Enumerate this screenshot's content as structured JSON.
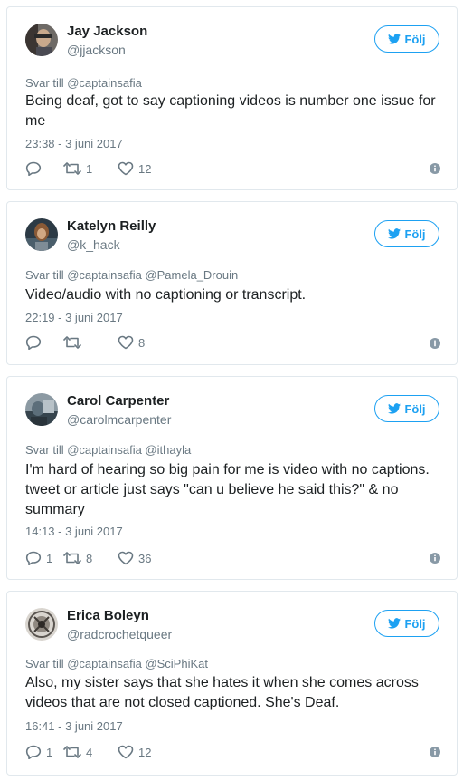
{
  "colors": {
    "accent": "#1da1f2",
    "secondary_text": "#697882",
    "primary_text": "#1c2022",
    "border": "#e1e8ed"
  },
  "tweets": [
    {
      "name": "Jay Jackson",
      "handle": "@jjackson",
      "follow_label": "Följ",
      "reply_to": "Svar till @captainsafia",
      "text_lines": [
        "Being deaf, got to say captioning videos is number one issue for",
        "me"
      ],
      "timestamp": "23:38 - 3 juni 2017",
      "replies": "",
      "retweets": "1",
      "likes": "12"
    },
    {
      "name": "Katelyn Reilly",
      "handle": "@k_hack",
      "follow_label": "Följ",
      "reply_to": "Svar till @captainsafia @Pamela_Drouin",
      "text_lines": [
        "Video/audio with no captioning or transcript."
      ],
      "timestamp": "22:19 - 3 juni 2017",
      "replies": "",
      "retweets": "",
      "likes": "8"
    },
    {
      "name": "Carol Carpenter",
      "handle": "@carolmcarpenter",
      "follow_label": "Följ",
      "reply_to": "Svar till @captainsafia @ithayla",
      "text_lines": [
        "I'm hard of hearing so big pain for me is video with no captions.",
        "tweet or article just says \"can u believe he said this?\" & no",
        "summary"
      ],
      "timestamp": "14:13 - 3 juni 2017",
      "replies": "1",
      "retweets": "8",
      "likes": "36"
    },
    {
      "name": "Erica Boleyn",
      "handle": "@radcrochetqueer",
      "follow_label": "Följ",
      "reply_to": "Svar till @captainsafia @SciPhiKat",
      "text_lines": [
        "Also, my sister says that she hates it when she comes across",
        "videos that are not closed captioned. She's Deaf."
      ],
      "timestamp": "16:41 - 3 juni 2017",
      "replies": "1",
      "retweets": "4",
      "likes": "12"
    }
  ],
  "icons": {
    "follow": "twitter-bird-icon",
    "reply": "reply-icon",
    "retweet": "retweet-icon",
    "like": "heart-icon",
    "info": "info-icon"
  }
}
